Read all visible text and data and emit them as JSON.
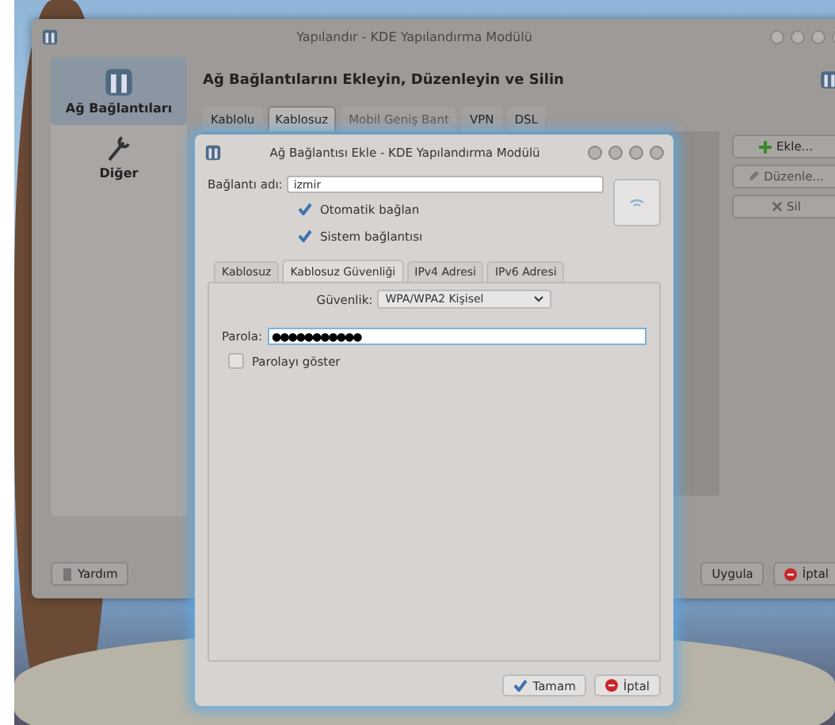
{
  "background_window": {
    "title": "Yapılandır - KDE Yapılandırma Modülü",
    "sidebar": {
      "items": [
        {
          "label": "Ağ Bağlantıları",
          "selected": true
        },
        {
          "label": "Diğer",
          "selected": false
        }
      ]
    },
    "heading": "Ağ Bağlantılarını Ekleyin, Düzenleyin ve Silin",
    "tabs": [
      {
        "label": "Kablolu",
        "selected": false,
        "disabled": false
      },
      {
        "label": "Kablosuz",
        "selected": true,
        "disabled": false
      },
      {
        "label": "Mobil Geniş Bant",
        "selected": false,
        "disabled": true
      },
      {
        "label": "VPN",
        "selected": false,
        "disabled": false
      },
      {
        "label": "DSL",
        "selected": false,
        "disabled": false
      }
    ],
    "side_buttons": [
      {
        "label": "Ekle...",
        "kind": "add",
        "disabled": false
      },
      {
        "label": "Düzenle...",
        "kind": "edit",
        "disabled": true
      },
      {
        "label": "Sil",
        "kind": "delete",
        "disabled": true
      }
    ],
    "footer_left_buttons": [
      {
        "label": "Yardım",
        "kind": "help"
      }
    ],
    "footer_right_buttons": [
      {
        "label": "Uygula",
        "kind": "apply"
      },
      {
        "label": "İptal",
        "kind": "cancel"
      }
    ]
  },
  "dialog": {
    "title": "Ağ Bağlantısı Ekle - KDE Yapılandırma Modülü",
    "connection_name": {
      "label": "Bağlantı adı:",
      "value": "izmir"
    },
    "options": [
      {
        "label": "Otomatik bağlan",
        "checked": true
      },
      {
        "label": "Sistem bağlantısı",
        "checked": true
      }
    ],
    "tabs": [
      {
        "label": "Kablosuz",
        "selected": false
      },
      {
        "label": "Kablosuz Güvenliği",
        "selected": true
      },
      {
        "label": "IPv4 Adresi",
        "selected": false
      },
      {
        "label": "IPv6 Adresi",
        "selected": false
      }
    ],
    "security": {
      "label": "Güvenlik:",
      "value": "WPA/WPA2 Kişisel"
    },
    "password": {
      "label": "Parola:",
      "value": "●●●●●●●●●●●"
    },
    "show_password": {
      "label": "Parolayı göster",
      "checked": false
    },
    "buttons": [
      {
        "label": "Tamam",
        "kind": "ok"
      },
      {
        "label": "İptal",
        "kind": "cancel"
      }
    ]
  }
}
